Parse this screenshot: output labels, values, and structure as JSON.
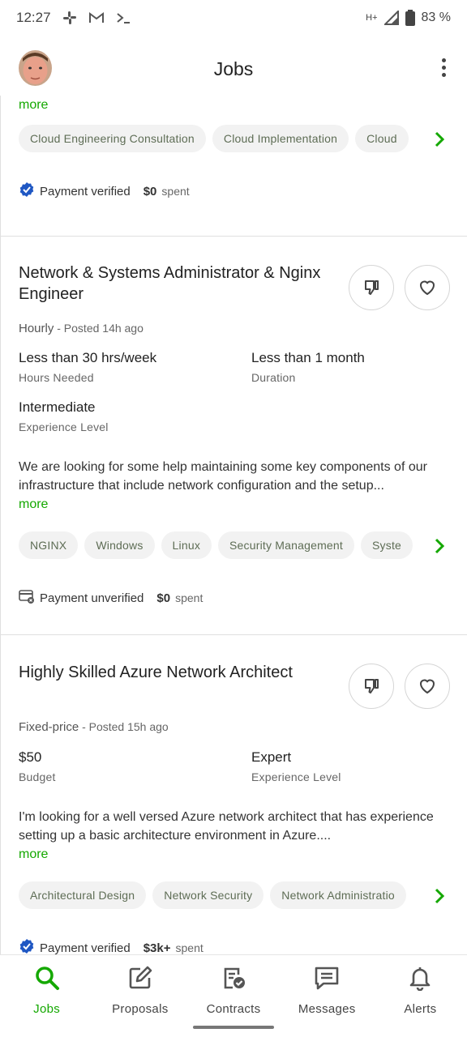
{
  "status_bar": {
    "time": "12:27",
    "network": "H+",
    "battery": "83 %"
  },
  "header": {
    "title": "Jobs"
  },
  "cards": [
    {
      "more": "more",
      "chips": [
        "Cloud Engineering Consultation",
        "Cloud Implementation",
        "Cloud"
      ],
      "payment": {
        "status": "Payment verified",
        "spent_amount": "$0",
        "spent_label": "spent"
      }
    },
    {
      "title": "Network & Systems Administrator & Nginx Engineer",
      "type": "Hourly",
      "posted": " - Posted 14h ago",
      "stats": [
        {
          "value": "Less than 30 hrs/week",
          "label": "Hours Needed"
        },
        {
          "value": "Less than 1 month",
          "label": "Duration"
        },
        {
          "value": "Intermediate",
          "label": "Experience Level"
        }
      ],
      "description": "We are looking for some help maintaining some key components of our infrastructure that include network configuration and the setup...",
      "more": "more",
      "chips": [
        "NGINX",
        "Windows",
        "Linux",
        "Security Management",
        "Syste"
      ],
      "payment": {
        "status": "Payment unverified",
        "spent_amount": "$0",
        "spent_label": "spent"
      }
    },
    {
      "title": "Highly Skilled Azure Network Architect",
      "type": "Fixed-price",
      "posted": " - Posted 15h ago",
      "stats": [
        {
          "value": "$50",
          "label": "Budget"
        },
        {
          "value": "Expert",
          "label": "Experience Level"
        }
      ],
      "description": "I'm looking for a well versed Azure network architect that has experience setting up a basic architecture environment in Azure....",
      "more": "more",
      "chips": [
        "Architectural Design",
        "Network Security",
        "Network Administratio"
      ],
      "payment": {
        "status": "Payment verified",
        "spent_amount": "$3k+",
        "spent_label": "spent"
      }
    }
  ],
  "nav": [
    {
      "label": "Jobs",
      "icon": "search-icon",
      "active": true
    },
    {
      "label": "Proposals",
      "icon": "proposals-icon"
    },
    {
      "label": "Contracts",
      "icon": "contracts-icon"
    },
    {
      "label": "Messages",
      "icon": "messages-icon"
    },
    {
      "label": "Alerts",
      "icon": "bell-icon"
    }
  ],
  "colors": {
    "accent": "#14a800",
    "verified": "#1f57c3"
  }
}
